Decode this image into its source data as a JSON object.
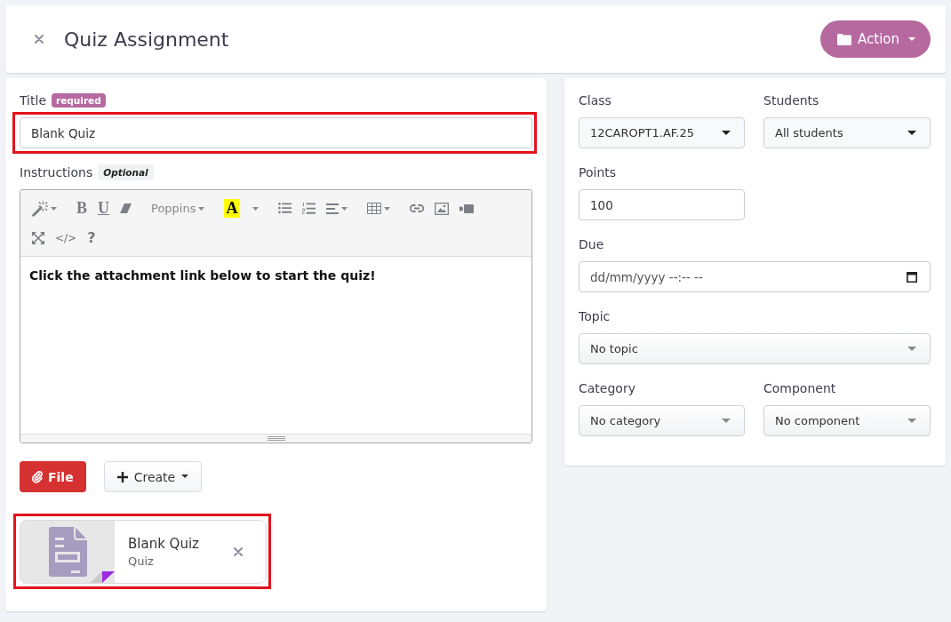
{
  "header": {
    "title": "Quiz Assignment",
    "action_button": {
      "label": "Action"
    }
  },
  "assignment": {
    "title_field": {
      "label": "Title",
      "badge": {
        "kind": "required",
        "text": "required"
      },
      "value": "Blank Quiz",
      "highlighted": true
    },
    "instructions": {
      "label": "Instructions",
      "badge": {
        "kind": "optional",
        "text": "Optional"
      },
      "toolbar": [
        [
          [
            {
              "kind": "style",
              "caret": true
            }
          ],
          [
            {
              "kind": "bold",
              "text": "B",
              "caret": false
            },
            {
              "kind": "underline",
              "text": "U",
              "caret": false
            },
            {
              "kind": "eraser",
              "caret": false
            }
          ],
          [
            {
              "kind": "font",
              "text": "Poppins",
              "caret": true
            }
          ],
          [
            {
              "kind": "color",
              "text": "A",
              "caret": false
            },
            {
              "kind": "dropdown",
              "caret": true
            }
          ],
          [
            {
              "kind": "bullets",
              "caret": false
            },
            {
              "kind": "numbering",
              "caret": false
            },
            {
              "kind": "align",
              "caret": true
            }
          ],
          [
            {
              "kind": "table",
              "caret": true
            }
          ],
          [
            {
              "kind": "link",
              "caret": false
            },
            {
              "kind": "picture",
              "caret": false
            },
            {
              "kind": "video",
              "caret": false
            }
          ]
        ],
        [
          [
            {
              "kind": "fullscreen",
              "caret": false
            },
            {
              "kind": "code",
              "text": "</>",
              "caret": false
            },
            {
              "kind": "help",
              "text": "?",
              "caret": false
            }
          ]
        ]
      ],
      "content": "Click the attachment link below to start the quiz!"
    },
    "buttons": [
      {
        "kind": "file",
        "label": "File"
      },
      {
        "kind": "create",
        "label": "Create"
      }
    ],
    "attachments": [
      {
        "title": "Blank Quiz",
        "type": "Quiz",
        "highlighted": true
      }
    ]
  },
  "settings": {
    "rows": [
      [
        {
          "label": "Class",
          "kind": "select",
          "value": "12CAROPT1.AF.25"
        },
        {
          "label": "Students",
          "kind": "select",
          "value": "All students"
        }
      ],
      [
        {
          "label": "Points",
          "kind": "input",
          "value": "100"
        }
      ],
      [
        {
          "label": "Due",
          "kind": "datetime",
          "placeholder": "dd/mm/yyyy --:-- --"
        }
      ],
      [
        {
          "label": "Topic",
          "kind": "picker",
          "value": "No topic"
        }
      ],
      [
        {
          "label": "Category",
          "kind": "picker",
          "value": "No category"
        },
        {
          "label": "Component",
          "kind": "picker",
          "value": "No component"
        }
      ]
    ]
  }
}
